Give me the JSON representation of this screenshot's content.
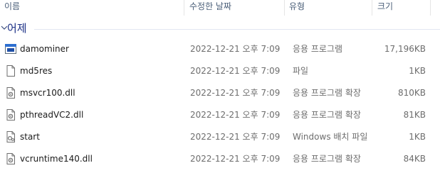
{
  "columns": {
    "name": "이름",
    "date": "수정한 날짜",
    "type": "유형",
    "size": "크기"
  },
  "group": {
    "label": "어제",
    "icon": "chevron-down-icon"
  },
  "files": [
    {
      "name": "damominer",
      "date": "2022-12-21 오후 7:09",
      "type": "응용 프로그램",
      "size": "17,196KB",
      "icon": "application-icon"
    },
    {
      "name": "md5res",
      "date": "2022-12-21 오후 7:09",
      "type": "파일",
      "size": "1KB",
      "icon": "file-icon"
    },
    {
      "name": "msvcr100.dll",
      "date": "2022-12-21 오후 7:09",
      "type": "응용 프로그램 확장",
      "size": "810KB",
      "icon": "dll-icon"
    },
    {
      "name": "pthreadVC2.dll",
      "date": "2022-12-21 오후 7:09",
      "type": "응용 프로그램 확장",
      "size": "81KB",
      "icon": "dll-icon"
    },
    {
      "name": "start",
      "date": "2022-12-21 오후 7:09",
      "type": "Windows 배치 파일",
      "size": "1KB",
      "icon": "batch-file-icon"
    },
    {
      "name": "vcruntime140.dll",
      "date": "2022-12-21 오후 7:09",
      "type": "응용 프로그램 확장",
      "size": "84KB",
      "icon": "dll-icon"
    }
  ]
}
